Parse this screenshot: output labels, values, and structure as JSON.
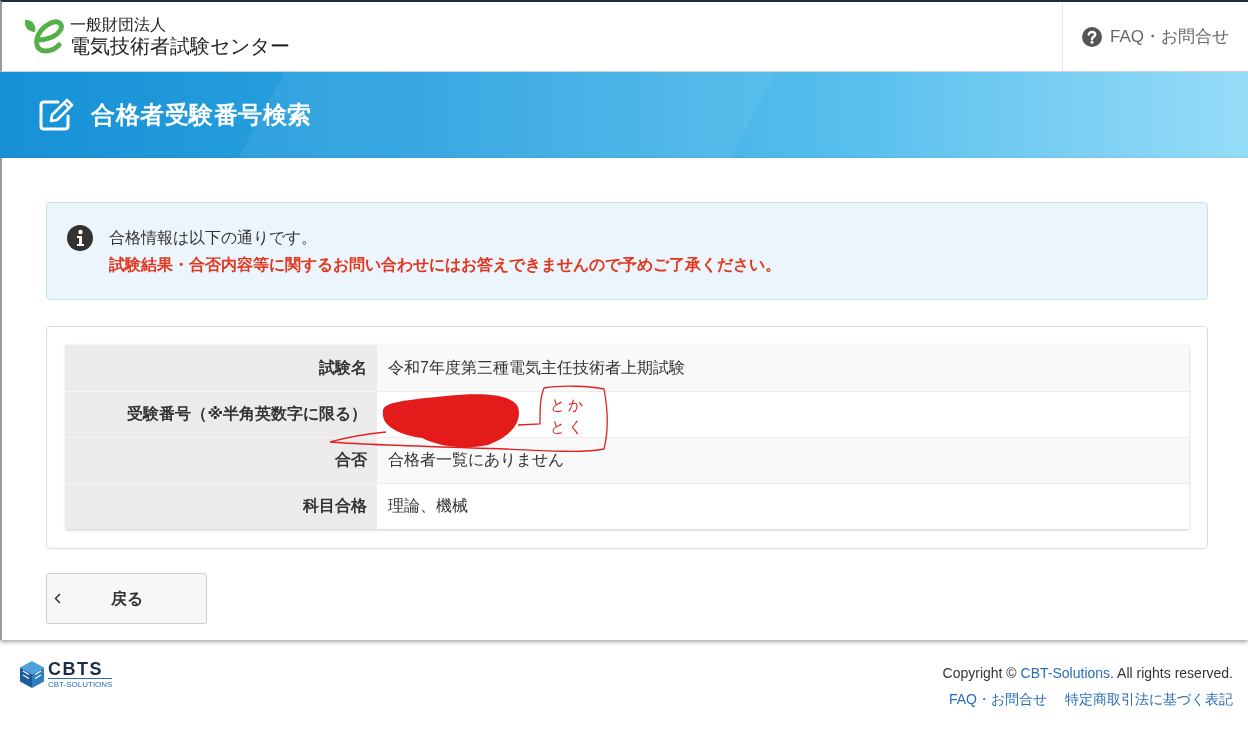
{
  "header": {
    "logo": {
      "org_type": "一般財団法人",
      "org_name": "電気技術者試験センター"
    },
    "help_link": "FAQ・お問合せ"
  },
  "page_title": "合格者受験番号検索",
  "notice": {
    "message": "合格情報は以下の通りです。",
    "warning": "試験結果・合否内容等に関するお問い合わせにはお答えできませんので予めご了承ください。"
  },
  "result_table": {
    "rows": [
      {
        "label": "試験名",
        "value": "令和7年度第三種電気主任技術者上期試験"
      },
      {
        "label": "受験番号（※半角英数字に限る）"
      },
      {
        "label": "合否",
        "value": "合格者一覧にありません"
      },
      {
        "label": "科目合格",
        "value": "理論、機械"
      }
    ]
  },
  "annotation": {
    "handwriting": [
      "とか",
      "とく"
    ]
  },
  "back_button": "戻る",
  "footer": {
    "logo": {
      "wordmark": "CBTS",
      "tagline": "CBT-SOLUTIONS"
    },
    "copyright": {
      "prefix": "Copyright © ",
      "link": "CBT-Solutions",
      "suffix": ". All rights reserved."
    },
    "links": [
      "FAQ・お問合せ",
      "特定商取引法に基づく表記"
    ]
  }
}
